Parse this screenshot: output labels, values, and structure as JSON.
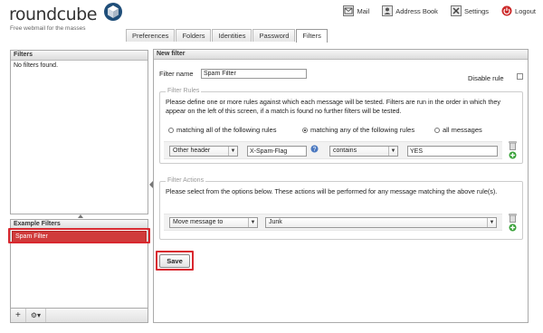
{
  "app": {
    "logo_text": "roundcube",
    "slogan": "Free webmail for the masses"
  },
  "topnav": {
    "mail": "Mail",
    "address_book": "Address Book",
    "settings": "Settings",
    "logout": "Logout"
  },
  "tabs": [
    {
      "label": "Preferences",
      "active": false
    },
    {
      "label": "Folders",
      "active": false
    },
    {
      "label": "Identities",
      "active": false
    },
    {
      "label": "Password",
      "active": false
    },
    {
      "label": "Filters",
      "active": true
    }
  ],
  "filters_panel": {
    "title": "Filters",
    "empty_text": "No filters found."
  },
  "sets_panel": {
    "title": "Example Filters",
    "items": [
      {
        "label": "Spam Filter",
        "selected": true
      }
    ],
    "add_label": "+",
    "actions_label": "⚙▾"
  },
  "main": {
    "title": "New filter",
    "filter_name_label": "Filter name",
    "filter_name_value": "Spam Filter",
    "disable_rule_label": "Disable rule",
    "rules": {
      "legend": "Filter Rules",
      "description": "Please define one or more rules against which each message will be tested. Filters are run in the order in which they appear on the left of this screen, if a match is found no further filters will be tested.",
      "options": [
        {
          "label": "matching all of the following rules",
          "checked": false
        },
        {
          "label": "matching any of the following rules",
          "checked": true
        },
        {
          "label": "all messages",
          "checked": false
        }
      ],
      "rule": {
        "header_select": "Other header",
        "header_name": "X-Spam-Flag",
        "operator_select": "contains",
        "value": "YES"
      }
    },
    "actions": {
      "legend": "Filter Actions",
      "description": "Please select from the options below. These actions will be performed for any message matching the above rule(s).",
      "action_select": "Move message to",
      "folder_select": "Junk"
    },
    "save_label": "Save"
  },
  "colors": {
    "highlight": "#d9282f",
    "selected_bg": "#d03b3b"
  }
}
